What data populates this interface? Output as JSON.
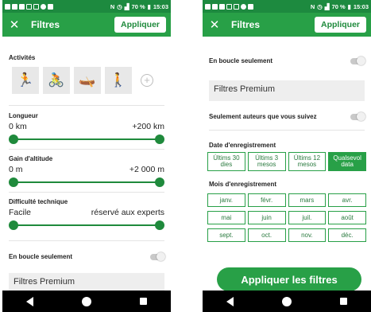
{
  "status_bar": {
    "battery": "70 %",
    "time": "15:03"
  },
  "header": {
    "title": "Filtres",
    "apply_label": "Appliquer"
  },
  "filters": {
    "activities_title": "Activités",
    "activities": [
      {
        "icon": "running-icon"
      },
      {
        "icon": "cycling-icon"
      },
      {
        "icon": "kayak-icon"
      },
      {
        "icon": "hiking-icon"
      }
    ],
    "length": {
      "title": "Longueur",
      "min_label": "0 km",
      "max_label": "+200 km",
      "min_value": 0,
      "max_value": 1
    },
    "elevation": {
      "title": "Gain d'altitude",
      "min_label": "0 m",
      "max_label": "+2 000 m",
      "min_value": 0,
      "max_value": 1
    },
    "difficulty": {
      "title": "Difficulté technique",
      "min_label": "Facile",
      "max_label": "réservé aux experts",
      "min_value": 0,
      "max_value": 1
    },
    "loop_only": {
      "label": "En boucle seulement",
      "enabled": false
    },
    "premium_title": "Filtres Premium",
    "followed_authors": {
      "label": "Seulement auteurs que vous suivez",
      "enabled": false
    },
    "recording_date": {
      "title": "Date d'enregistrement",
      "options": [
        {
          "label": "Últims 30 dies",
          "active": false
        },
        {
          "label": "Últims 3 mesos",
          "active": false
        },
        {
          "label": "Últims 12 mesos",
          "active": false
        },
        {
          "label": "Qualsevol data",
          "active": true
        }
      ]
    },
    "recording_month": {
      "title": "Mois d'enregistrement",
      "months": [
        "janv.",
        "févr.",
        "mars",
        "avr.",
        "mai",
        "juin",
        "juil.",
        "août",
        "sept.",
        "oct.",
        "nov.",
        "déc."
      ]
    }
  },
  "apply_filters_label": "Appliquer les filtres",
  "colors": {
    "primary": "#28a047",
    "status_bar": "#1d8a3f"
  }
}
